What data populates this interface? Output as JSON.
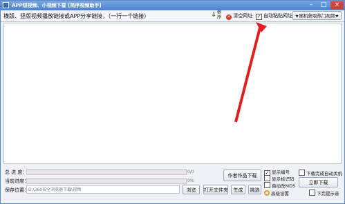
{
  "window": {
    "title": "APP短视频、小视频下载 [简序视频助手]"
  },
  "toolbar": {
    "prompt": "横版、竖版视频播放链接或APP分享链接，（一行一个链接）",
    "download_icon": "↓",
    "vertical_char_1": "倒",
    "vertical_char_2": "序",
    "clear_label": "清空网址",
    "auto_paste_label": "自动粘贴网址",
    "auto_paste_checked": true,
    "random_hot_label": "★随机获取热门视频★"
  },
  "progress": {
    "total_label": "总 进 度：",
    "total_text": "0/0",
    "current_label": "当前进度：",
    "current_text": "0%",
    "total_value": 0,
    "current_value": 0
  },
  "save": {
    "label": "保存位置：",
    "path": "D:\\360安全浏览器下载\\视频",
    "browse_label": "浏览",
    "open_folder_label": "打开文件夹"
  },
  "actions": {
    "author_download": "作者作品下载",
    "generate": "生成",
    "select": "挑选",
    "download_now": "立即下载"
  },
  "options": {
    "show_number": "显示编号",
    "show_number_checked": true,
    "show_id": "显示标识码",
    "show_id_checked": false,
    "auto_md5": "自动改MD5",
    "auto_md5_checked": false,
    "advanced": "高级设置",
    "auto_shutdown": "下载完成自动关机",
    "auto_shutdown_checked": false,
    "finish_prompt": "下完提示音",
    "finish_prompt_checked": false
  },
  "colors": {
    "title_bar": "#4a82cf",
    "arrow": "#e02020"
  }
}
